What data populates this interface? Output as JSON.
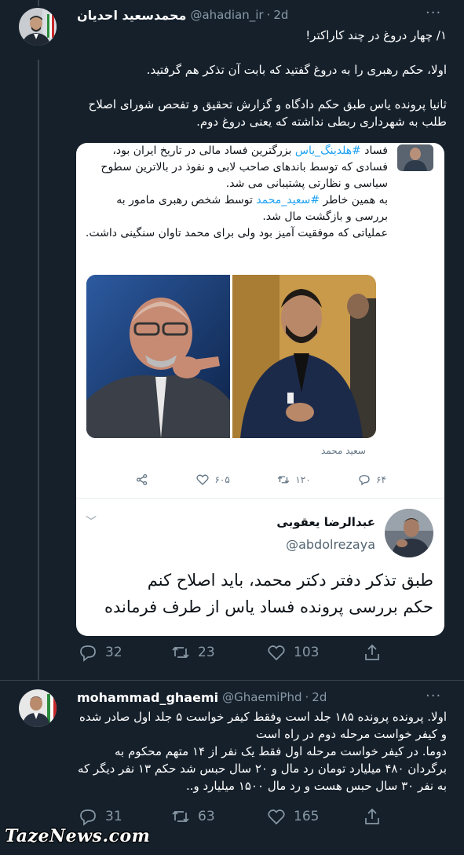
{
  "tweet1": {
    "display_name": "محمدسعید احدیان",
    "handle": "@ahadian_ir",
    "time": "2d",
    "text": "۱/ چهار دروغ در چند کاراکتر!\n\nاولا، حکم رهبری را به دروغ گفتید که بابت آن تذکر هم گرفتید.\n\nثانیا پرونده یاس طبق حکم دادگاه و گزارش تحقیق و تفحص شورای اصلاح طلب به شهرداری ربطی نداشته که یعنی دروغ دوم.",
    "quote": {
      "text_part1": "فساد ",
      "hashtag1": "#هلدینگ_یاس",
      "text_part2": " بزرگترین فساد مالی در تاریخ ایران بود، فسادی که توسط باندهای صاحب لابی و نفوذ در بالاترین سطوح سیاسی و نظارتی پشتیبانی می شد.\nبه همین خاطر ",
      "hashtag2": "#سعید_محمد",
      "text_part3": " توسط شخص رهبری مامور به بررسی و بازگشت مال شد.\nعملیاتی که موفقیت آمیز بود ولی برای محمد تاوان سنگینی داشت.",
      "photo_caption": "سعید محمد",
      "likes": "۶۰۵",
      "retweets": "۱۲۰",
      "replies": "۶۴",
      "author_name": "عبدالرضا یعقوبی",
      "author_handle": "@abdolrezaya",
      "big_text": "طبق تذکر دفتر دکتر محمد، باید اصلاح کنم\nحکم بررسی پرونده فساد یاس از طرف فرمانده"
    },
    "stats": {
      "replies": "32",
      "retweets": "23",
      "likes": "103"
    }
  },
  "tweet2": {
    "display_name": "mohammad_ghaemi",
    "handle": "@GhaemiPhd",
    "time": "2d",
    "text": "اولا. پرونده پرونده ۱۸۵ جلد است وفقط کیفر خواست ۵ جلد اول صادر شده و کیفر خواست مرحله دوم در راه است\nدوما. در کیفر خواست مرحله اول فقط یک نفر از ۱۴ متهم محکوم به برگردان ۴۸۰ میلیارد تومان رد مال و ۲۰ سال حبس شد حکم ۱۳ نفر دیگر که به نفر ۳۰ سال حبس هست و رد مال ۱۵۰۰ میلیارد و..",
    "stats": {
      "replies": "31",
      "retweets": "63",
      "likes": "165"
    }
  },
  "watermark": "TazeNews.com",
  "colors": {
    "background": "#15202b",
    "accent": "#1da1f2",
    "muted": "#8899a6"
  }
}
